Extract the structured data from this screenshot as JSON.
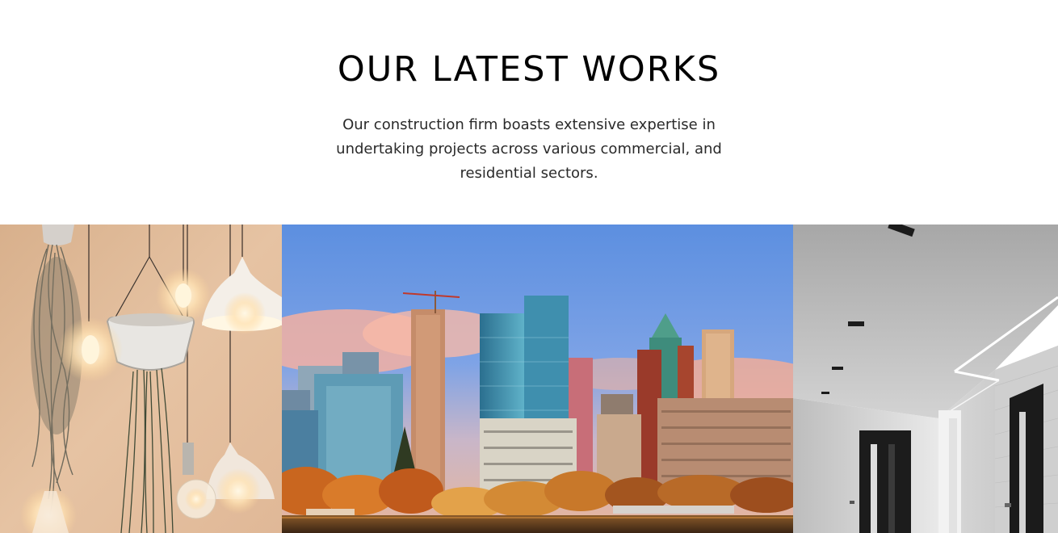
{
  "section": {
    "title": "OUR LATEST WORKS",
    "description": "Our construction firm boasts extensive expertise in undertaking projects across various commercial, and residential sectors."
  },
  "gallery": {
    "items": [
      {
        "subject": "hanging-lamps-and-plants"
      },
      {
        "subject": "city-skyline"
      },
      {
        "subject": "white-interior-hallway"
      }
    ]
  }
}
